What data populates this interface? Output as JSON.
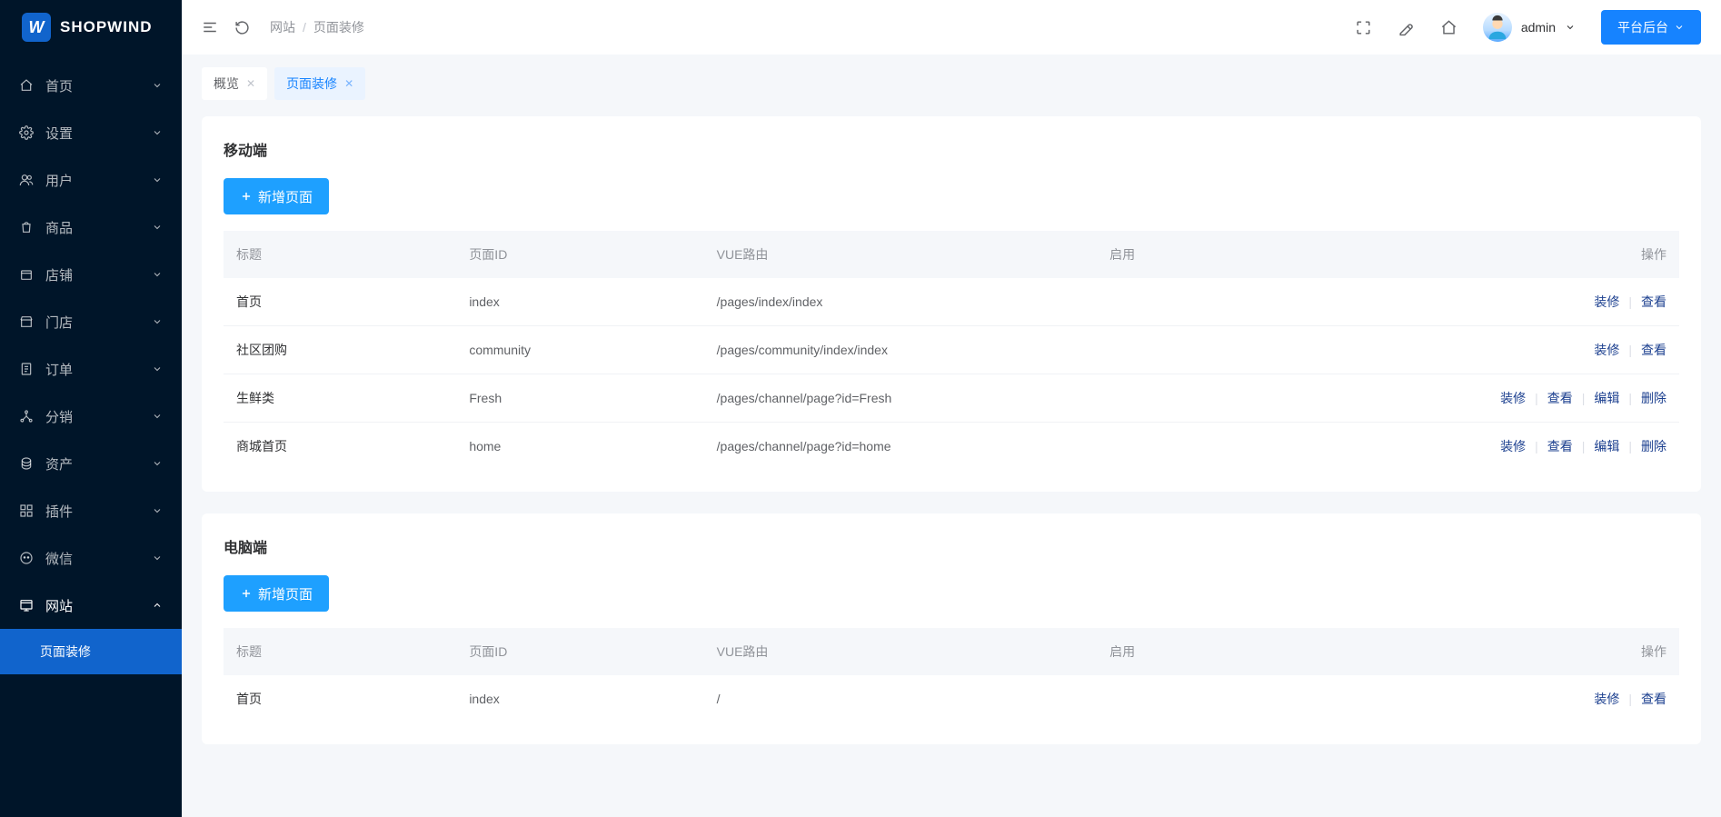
{
  "brand": {
    "name": "SHOPWIND",
    "mark": "W"
  },
  "sidebar": {
    "items": [
      {
        "key": "home",
        "label": "首页"
      },
      {
        "key": "settings",
        "label": "设置"
      },
      {
        "key": "users",
        "label": "用户"
      },
      {
        "key": "goods",
        "label": "商品"
      },
      {
        "key": "stores",
        "label": "店铺"
      },
      {
        "key": "shops",
        "label": "门店"
      },
      {
        "key": "orders",
        "label": "订单"
      },
      {
        "key": "distribution",
        "label": "分销"
      },
      {
        "key": "assets",
        "label": "资产"
      },
      {
        "key": "plugins",
        "label": "插件"
      },
      {
        "key": "wechat",
        "label": "微信"
      },
      {
        "key": "website",
        "label": "网站"
      }
    ],
    "submenu": {
      "active": "页面装修"
    }
  },
  "header": {
    "breadcrumb": [
      "网站",
      "页面装修"
    ],
    "user_name": "admin",
    "platform_button": "平台后台"
  },
  "tabs": [
    {
      "label": "概览",
      "active": false
    },
    {
      "label": "页面装修",
      "active": true
    }
  ],
  "sections": [
    {
      "title": "移动端",
      "add_label": "新增页面",
      "columns": [
        "标题",
        "页面ID",
        "VUE路由",
        "启用",
        "操作"
      ],
      "rows": [
        {
          "title": "首页",
          "page_id": "index",
          "route": "/pages/index/index",
          "enable": "",
          "ops": [
            "装修",
            "查看"
          ]
        },
        {
          "title": "社区团购",
          "page_id": "community",
          "route": "/pages/community/index/index",
          "enable": "",
          "ops": [
            "装修",
            "查看"
          ]
        },
        {
          "title": "生鲜类",
          "page_id": "Fresh",
          "route": "/pages/channel/page?id=Fresh",
          "enable": "",
          "ops": [
            "装修",
            "查看",
            "编辑",
            "删除"
          ]
        },
        {
          "title": "商城首页",
          "page_id": "home",
          "route": "/pages/channel/page?id=home",
          "enable": "",
          "ops": [
            "装修",
            "查看",
            "编辑",
            "删除"
          ]
        }
      ]
    },
    {
      "title": "电脑端",
      "add_label": "新增页面",
      "columns": [
        "标题",
        "页面ID",
        "VUE路由",
        "启用",
        "操作"
      ],
      "rows": [
        {
          "title": "首页",
          "page_id": "index",
          "route": "/",
          "enable": "",
          "ops": [
            "装修",
            "查看"
          ]
        }
      ]
    }
  ]
}
